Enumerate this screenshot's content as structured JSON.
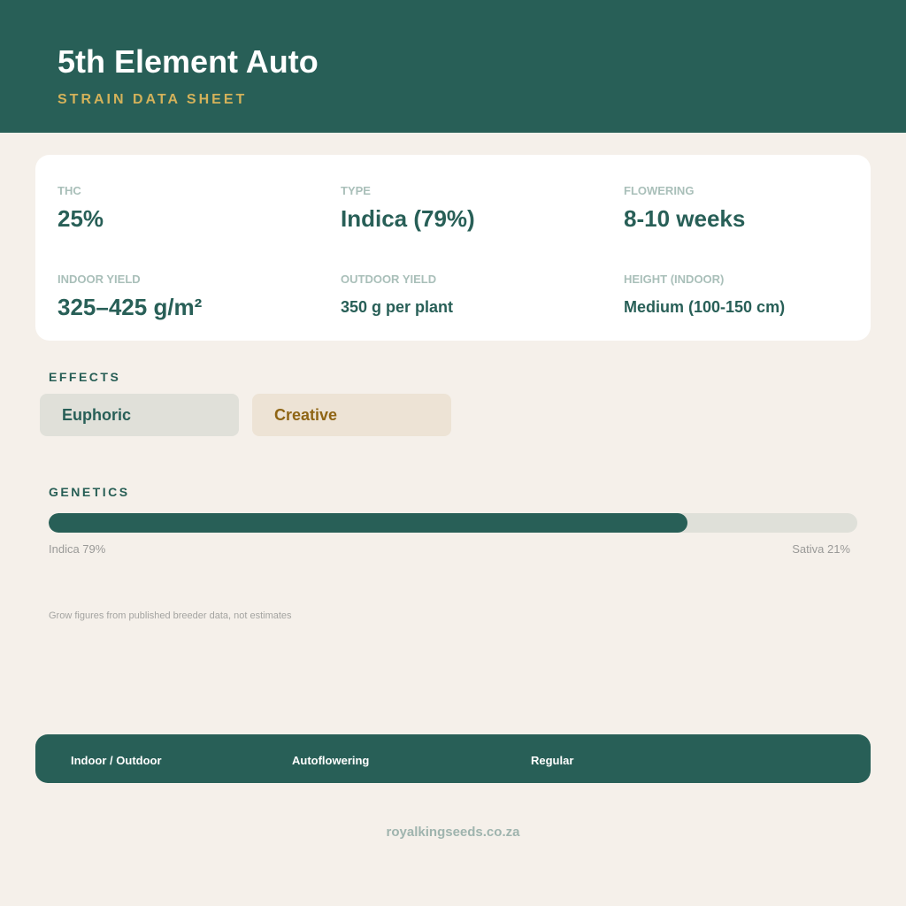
{
  "header": {
    "title": "5th Element Auto",
    "subtitle": "STRAIN DATA SHEET"
  },
  "stats": {
    "thc": {
      "label": "THC",
      "value": "25%"
    },
    "type": {
      "label": "TYPE",
      "value": "Indica (79%)"
    },
    "flowering": {
      "label": "FLOWERING",
      "value": "8-10 weeks"
    },
    "indoor_yield": {
      "label": "INDOOR YIELD",
      "value": "325–425 g/m²"
    },
    "outdoor_yield": {
      "label": "OUTDOOR YIELD",
      "value": "350 g per plant"
    },
    "height": {
      "label": "HEIGHT (INDOOR)",
      "value": "Medium (100-150 cm)"
    }
  },
  "effects": {
    "label": "EFFECTS",
    "items": [
      "Euphoric",
      "Creative"
    ]
  },
  "genetics": {
    "label": "GENETICS",
    "indica_percent": 79,
    "indica_label": "Indica 79%",
    "sativa_label": "Sativa 21%"
  },
  "note": "Grow figures from published breeder data, not estimates",
  "footer": {
    "tags": [
      "Indoor / Outdoor",
      "Autoflowering",
      "Regular"
    ]
  },
  "site": "royalkingseeds.co.za",
  "colors": {
    "primary": "#285f57",
    "accent": "#d4b25a",
    "background": "#f5f0ea"
  }
}
